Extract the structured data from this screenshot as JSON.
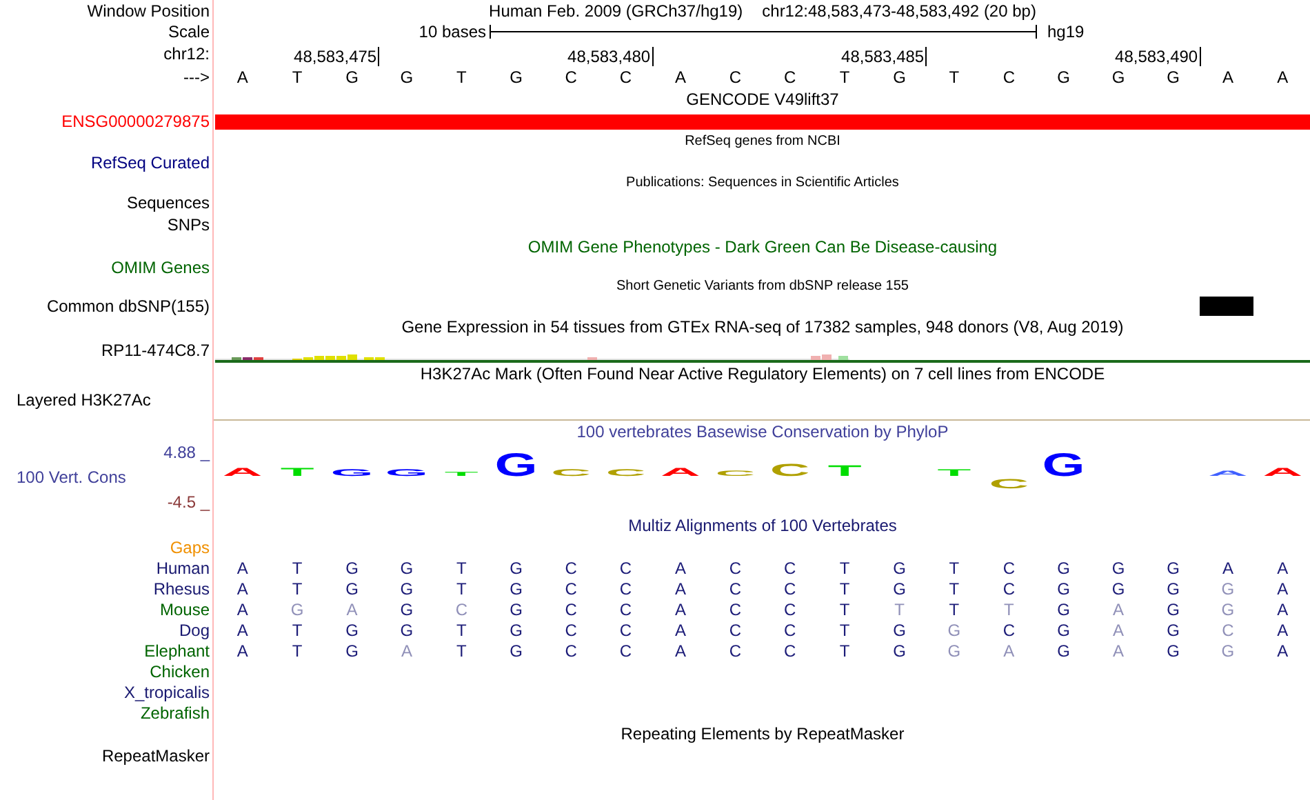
{
  "ruler": {
    "position_label": "Window Position",
    "assembly": "Human Feb. 2009 (GRCh37/hg19)",
    "position": "chr12:48,583,473-48,583,492 (20 bp)",
    "scale_label": "Scale",
    "scale_text": "10 bases",
    "scale_db": "hg19",
    "chrom_label": "chr12:",
    "ticks": [
      "48,583,475",
      "48,583,480",
      "48,583,485",
      "48,583,490"
    ],
    "strand_label": "--->",
    "bases": [
      "A",
      "T",
      "G",
      "G",
      "T",
      "G",
      "C",
      "C",
      "A",
      "C",
      "C",
      "T",
      "G",
      "T",
      "C",
      "G",
      "G",
      "G",
      "A",
      "A"
    ]
  },
  "tracks": [
    {
      "kind": "gene",
      "title": "GENCODE V49lift37",
      "label": "ENSG00000279875",
      "color": "#ff0000"
    },
    {
      "kind": "collapsed",
      "title": "RefSeq genes from NCBI",
      "label": "RefSeq Curated",
      "color": "#000080"
    },
    {
      "kind": "pub",
      "title": "Publications: Sequences in Scientific Articles"
    },
    {
      "kind": "label",
      "label": "Sequences"
    },
    {
      "kind": "label",
      "label": "SNPs"
    },
    {
      "kind": "omim",
      "title": "OMIM Gene Phenotypes - Dark Green Can Be Disease-causing",
      "label": "OMIM Genes",
      "color": "#006400"
    },
    {
      "kind": "snp",
      "title": "Short Genetic Variants from dbSNP release 155",
      "label": "Common dbSNP(155)"
    },
    {
      "kind": "expression",
      "title": "Gene Expression in 54 tissues from GTEx RNA-seq of 17382 samples, 948 donors (V8, Aug 2019)",
      "label": "RP11-474C8.7"
    },
    {
      "kind": "signal",
      "title": "H3K27Ac Mark (Often Found Near Active Regulatory Elements) on 7 cell lines from ENCODE",
      "label": "Layered H3K27Ac"
    },
    {
      "kind": "conservation",
      "title": "100 vertebrates Basewise Conservation by PhyloP",
      "label": "100 Vert. Cons",
      "color": "#40409a",
      "ymax": "4.88 _",
      "ymin": "-4.5 _",
      "logo": [
        "A",
        "T",
        "G",
        "G",
        "T",
        "G",
        "C",
        "C",
        "A",
        "C",
        "C",
        "T",
        "T",
        "C",
        "G",
        "A",
        "A"
      ]
    },
    {
      "kind": "alignment",
      "title": "Multiz Alignments of 100 Vertebrates",
      "color": "#191970",
      "rows": [
        {
          "name": "Gaps",
          "color": "#f09000"
        },
        {
          "name": "Human",
          "color": "#191970",
          "bases": [
            {
              "base": "A",
              "match": true
            },
            {
              "base": "T",
              "match": true
            },
            {
              "base": "G",
              "match": true
            },
            {
              "base": "G",
              "match": true
            },
            {
              "base": "T",
              "match": true
            },
            {
              "base": "G",
              "match": true
            },
            {
              "base": "C",
              "match": true
            },
            {
              "base": "C",
              "match": true
            },
            {
              "base": "A",
              "match": true
            },
            {
              "base": "C",
              "match": true
            },
            {
              "base": "C",
              "match": true
            },
            {
              "base": "T",
              "match": true
            },
            {
              "base": "G",
              "match": true
            },
            {
              "base": "T",
              "match": true
            },
            {
              "base": "C",
              "match": true
            },
            {
              "base": "G",
              "match": true
            },
            {
              "base": "G",
              "match": true
            },
            {
              "base": "G",
              "match": true
            },
            {
              "base": "A",
              "match": true
            },
            {
              "base": "A",
              "match": true
            }
          ]
        },
        {
          "name": "Rhesus",
          "color": "#191970",
          "bases": [
            {
              "base": "A",
              "match": true
            },
            {
              "base": "T",
              "match": true
            },
            {
              "base": "G",
              "match": true
            },
            {
              "base": "G",
              "match": true
            },
            {
              "base": "T",
              "match": true
            },
            {
              "base": "G",
              "match": true
            },
            {
              "base": "C",
              "match": true
            },
            {
              "base": "C",
              "match": true
            },
            {
              "base": "A",
              "match": true
            },
            {
              "base": "C",
              "match": true
            },
            {
              "base": "C",
              "match": true
            },
            {
              "base": "T",
              "match": true
            },
            {
              "base": "G",
              "match": true
            },
            {
              "base": "T",
              "match": true
            },
            {
              "base": "C",
              "match": true
            },
            {
              "base": "G",
              "match": true
            },
            {
              "base": "G",
              "match": true
            },
            {
              "base": "G",
              "match": true
            },
            {
              "base": "G",
              "match": false
            },
            {
              "base": "A",
              "match": true
            }
          ]
        },
        {
          "name": "Mouse",
          "color": "#006400",
          "bases": [
            {
              "base": "A",
              "match": true
            },
            {
              "base": "G",
              "match": false
            },
            {
              "base": "A",
              "match": false
            },
            {
              "base": "G",
              "match": true
            },
            {
              "base": "C",
              "match": false
            },
            {
              "base": "G",
              "match": true
            },
            {
              "base": "C",
              "match": true
            },
            {
              "base": "C",
              "match": true
            },
            {
              "base": "A",
              "match": true
            },
            {
              "base": "C",
              "match": true
            },
            {
              "base": "C",
              "match": true
            },
            {
              "base": "T",
              "match": true
            },
            {
              "base": "T",
              "match": false
            },
            {
              "base": "T",
              "match": true
            },
            {
              "base": "T",
              "match": false
            },
            {
              "base": "G",
              "match": true
            },
            {
              "base": "A",
              "match": false
            },
            {
              "base": "G",
              "match": true
            },
            {
              "base": "G",
              "match": false
            },
            {
              "base": "A",
              "match": true
            }
          ]
        },
        {
          "name": "Dog",
          "color": "#191970",
          "bases": [
            {
              "base": "A",
              "match": true
            },
            {
              "base": "T",
              "match": true
            },
            {
              "base": "G",
              "match": true
            },
            {
              "base": "G",
              "match": true
            },
            {
              "base": "T",
              "match": true
            },
            {
              "base": "G",
              "match": true
            },
            {
              "base": "C",
              "match": true
            },
            {
              "base": "C",
              "match": true
            },
            {
              "base": "A",
              "match": true
            },
            {
              "base": "C",
              "match": true
            },
            {
              "base": "C",
              "match": true
            },
            {
              "base": "T",
              "match": true
            },
            {
              "base": "G",
              "match": true
            },
            {
              "base": "G",
              "match": false
            },
            {
              "base": "C",
              "match": true
            },
            {
              "base": "G",
              "match": true
            },
            {
              "base": "A",
              "match": false
            },
            {
              "base": "G",
              "match": true
            },
            {
              "base": "C",
              "match": false
            },
            {
              "base": "A",
              "match": true
            }
          ]
        },
        {
          "name": "Elephant",
          "color": "#006400",
          "bases": [
            {
              "base": "A",
              "match": true
            },
            {
              "base": "T",
              "match": true
            },
            {
              "base": "G",
              "match": true
            },
            {
              "base": "A",
              "match": false
            },
            {
              "base": "T",
              "match": true
            },
            {
              "base": "G",
              "match": true
            },
            {
              "base": "C",
              "match": true
            },
            {
              "base": "C",
              "match": true
            },
            {
              "base": "A",
              "match": true
            },
            {
              "base": "C",
              "match": true
            },
            {
              "base": "C",
              "match": true
            },
            {
              "base": "T",
              "match": true
            },
            {
              "base": "G",
              "match": true
            },
            {
              "base": "G",
              "match": false
            },
            {
              "base": "A",
              "match": false
            },
            {
              "base": "G",
              "match": true
            },
            {
              "base": "A",
              "match": false
            },
            {
              "base": "G",
              "match": true
            },
            {
              "base": "G",
              "match": false
            },
            {
              "base": "A",
              "match": true
            }
          ]
        },
        {
          "name": "Chicken",
          "color": "#006400"
        },
        {
          "name": "X_tropicalis",
          "color": "#191970"
        },
        {
          "name": "Zebrafish",
          "color": "#006400"
        }
      ]
    },
    {
      "kind": "repeat",
      "title": "Repeating Elements by RepeatMasker",
      "label": "RepeatMasker"
    }
  ]
}
